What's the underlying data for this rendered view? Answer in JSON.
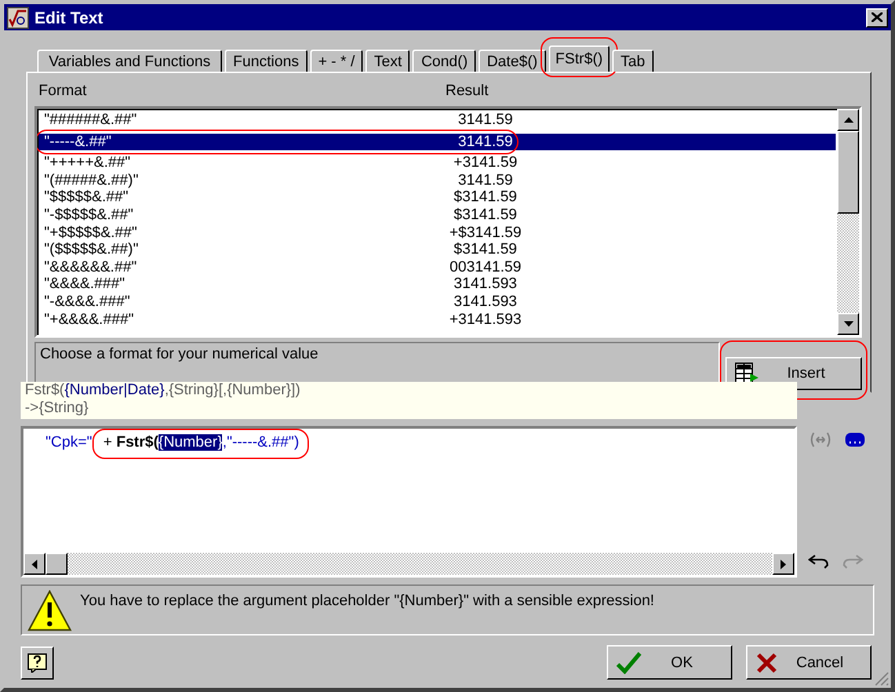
{
  "window": {
    "title": "Edit Text"
  },
  "tabs": [
    {
      "label": "Variables and Functions",
      "selected": false,
      "circled": false
    },
    {
      "label": "Functions",
      "selected": false,
      "circled": false
    },
    {
      "label": "+ - * /",
      "selected": false,
      "circled": false
    },
    {
      "label": "Text",
      "selected": false,
      "circled": false
    },
    {
      "label": "Cond()",
      "selected": false,
      "circled": false
    },
    {
      "label": "Date$()",
      "selected": false,
      "circled": false
    },
    {
      "label": "FStr$()",
      "selected": true,
      "circled": true
    },
    {
      "label": "Tab",
      "selected": false,
      "circled": false
    }
  ],
  "format_list": {
    "columns": [
      "Format",
      "Result"
    ],
    "rows": [
      {
        "format": "\"######&.##\"",
        "result": "3141.59",
        "selected": false,
        "circled": false
      },
      {
        "format": "\"-----&.##\"",
        "result": "3141.59",
        "selected": true,
        "circled": true
      },
      {
        "format": "\"+++++&.##\"",
        "result": "+3141.59",
        "selected": false,
        "circled": false
      },
      {
        "format": "\"(#####&.##)\"",
        "result": "3141.59",
        "selected": false,
        "circled": false
      },
      {
        "format": "\"$$$$$&.##\"",
        "result": "$3141.59",
        "selected": false,
        "circled": false
      },
      {
        "format": "\"-$$$$$&.##\"",
        "result": "$3141.59",
        "selected": false,
        "circled": false
      },
      {
        "format": "\"+$$$$$&.##\"",
        "result": "+$3141.59",
        "selected": false,
        "circled": false
      },
      {
        "format": "\"($$$$$&.##)\"",
        "result": "$3141.59",
        "selected": false,
        "circled": false
      },
      {
        "format": "\"&&&&&&.##\"",
        "result": "003141.59",
        "selected": false,
        "circled": false
      },
      {
        "format": "\"&&&&.###\"",
        "result": "3141.593",
        "selected": false,
        "circled": false
      },
      {
        "format": "\"-&&&&.###\"",
        "result": "3141.593",
        "selected": false,
        "circled": false
      },
      {
        "format": "\"+&&&&.###\"",
        "result": "+3141.593",
        "selected": false,
        "circled": false
      }
    ]
  },
  "description": "Choose a format for your numerical value",
  "insert_button": {
    "label": "Insert",
    "circled": true
  },
  "tooltip": {
    "lines": [
      "Fstr$(**{Number|Date}**,{String}[,{Number}])",
      "->{String}"
    ]
  },
  "editor": {
    "segments": [
      {
        "kind": "string",
        "text": "\"Cpk=\"",
        "circled": false
      },
      {
        "kind": "operator",
        "text": " + ",
        "circled": true
      },
      {
        "kind": "function",
        "text": "Fstr$(",
        "circled": true
      },
      {
        "kind": "placeholder",
        "text": "{Number}",
        "circled": true
      },
      {
        "kind": "string",
        "text": ",\"-----&.##\")",
        "circled": true
      }
    ]
  },
  "warning": "You have to replace the argument placeholder \"{Number}\" with a sensible expression!",
  "buttons": [
    {
      "kind": "ok",
      "label": "OK"
    },
    {
      "kind": "cancel",
      "label": "Cancel"
    }
  ]
}
